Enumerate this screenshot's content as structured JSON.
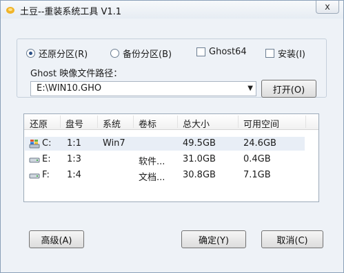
{
  "window": {
    "title": "土豆--重装系统工具 V1.1",
    "close_glyph": "x"
  },
  "options": {
    "restore": "还原分区(R)",
    "backup": "备份分区(B)",
    "ghost64": "Ghost64",
    "install": "安装(I)",
    "selected": "restore"
  },
  "image_path": {
    "label": "Ghost 映像文件路径：",
    "value": "E:\\WIN10.GHO",
    "open_button": "打开(O)"
  },
  "table": {
    "headers": [
      "还原",
      "盘号",
      "系统",
      "卷标",
      "总大小",
      "可用空间"
    ],
    "rows": [
      {
        "drive": "C:",
        "disk": "1:1",
        "system": "Win7",
        "label": "",
        "total": "49.5GB",
        "free": "24.6GB",
        "icon": "windows-drive-icon"
      },
      {
        "drive": "E:",
        "disk": "1:3",
        "system": "",
        "label": "软件...",
        "total": "31.0GB",
        "free": "0.4GB",
        "icon": "disk-drive-icon"
      },
      {
        "drive": "F:",
        "disk": "1:4",
        "system": "",
        "label": "文档...",
        "total": "30.8GB",
        "free": "7.1GB",
        "icon": "disk-drive-icon"
      }
    ]
  },
  "buttons": {
    "advanced": "高级(A)",
    "ok": "确定(Y)",
    "cancel": "取消(C)"
  }
}
